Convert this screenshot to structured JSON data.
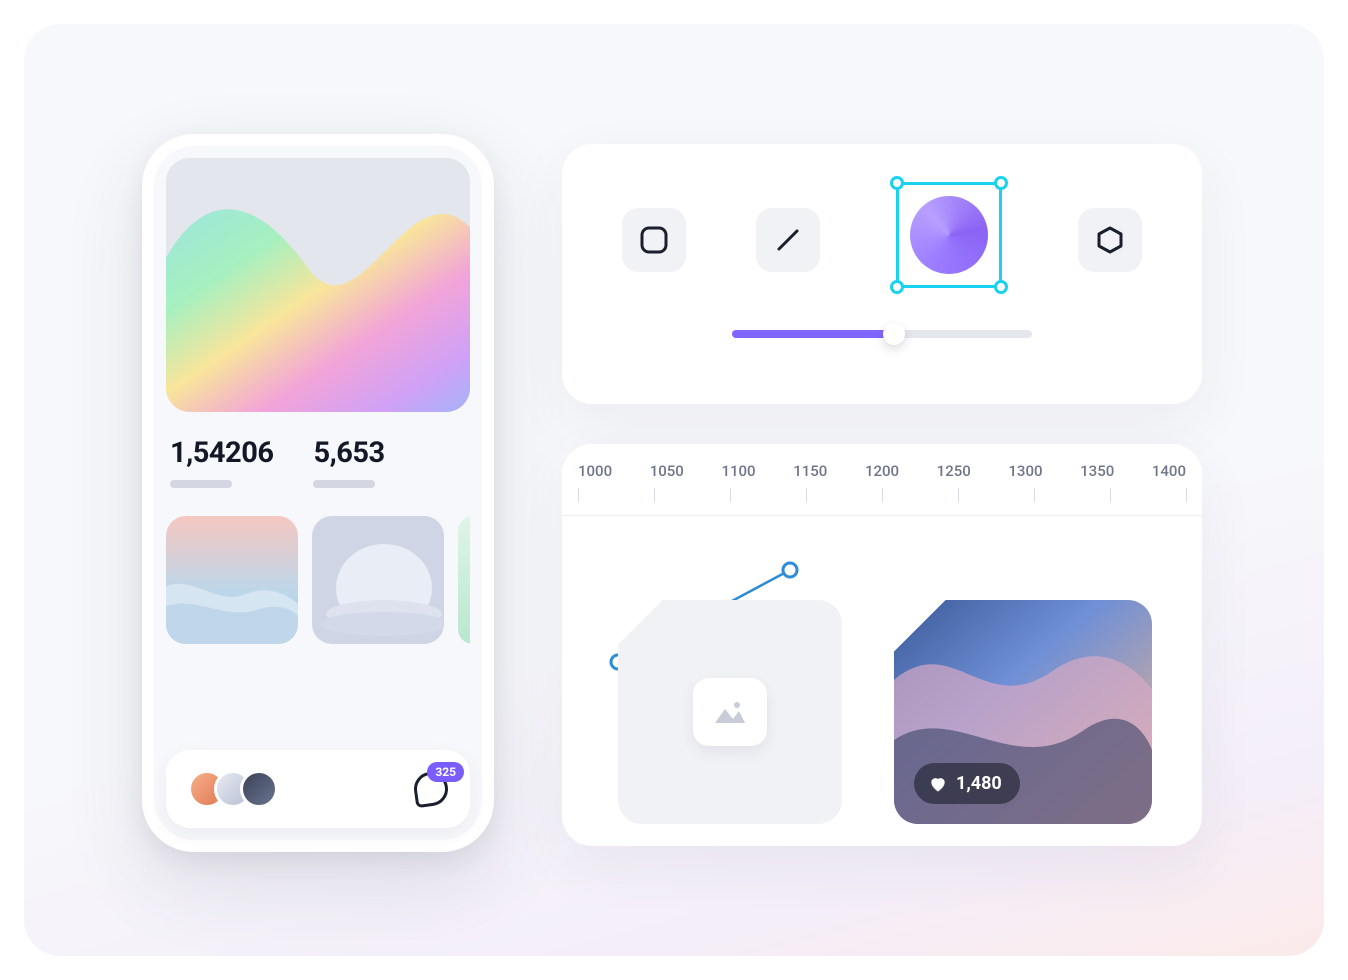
{
  "phone": {
    "stat1": "1,54206",
    "stat2": "5,653",
    "chat_badge": "325"
  },
  "tools": {
    "icons": [
      "square",
      "line",
      "circle-selected",
      "hexagon"
    ],
    "slider_percent": 54
  },
  "timeline": {
    "ticks": [
      "1000",
      "1050",
      "1100",
      "1150",
      "1200",
      "1250",
      "1300",
      "1350",
      "1400"
    ],
    "likes": "1,480"
  },
  "colors": {
    "accent_cyan": "#18d2f0",
    "accent_purple": "#8265ff"
  }
}
